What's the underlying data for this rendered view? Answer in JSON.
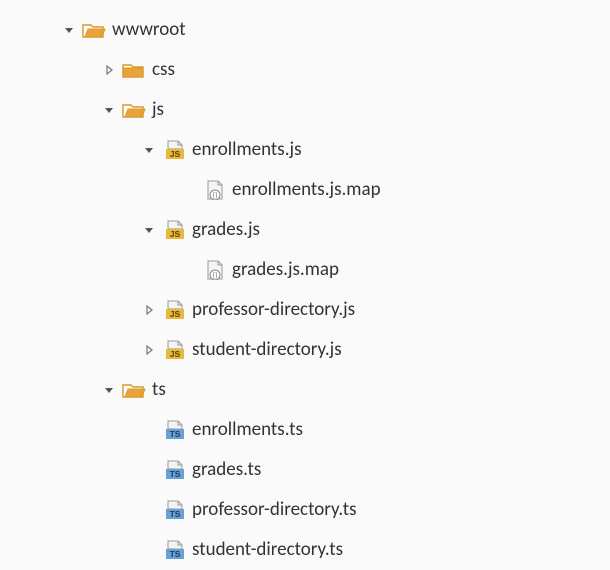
{
  "tree": {
    "wwwroot": {
      "label": "wwwroot",
      "css": {
        "label": "css"
      },
      "js": {
        "label": "js",
        "enrollments_js": {
          "label": "enrollments.js",
          "map": {
            "label": "enrollments.js.map"
          }
        },
        "grades_js": {
          "label": "grades.js",
          "map": {
            "label": "grades.js.map"
          }
        },
        "professor_directory_js": {
          "label": "professor-directory.js"
        },
        "student_directory_js": {
          "label": "student-directory.js"
        }
      },
      "ts": {
        "label": "ts",
        "enrollments_ts": {
          "label": "enrollments.ts"
        },
        "grades_ts": {
          "label": "grades.ts"
        },
        "professor_directory_ts": {
          "label": "professor-directory.ts"
        },
        "student_directory_ts": {
          "label": "student-directory.ts"
        }
      }
    }
  }
}
